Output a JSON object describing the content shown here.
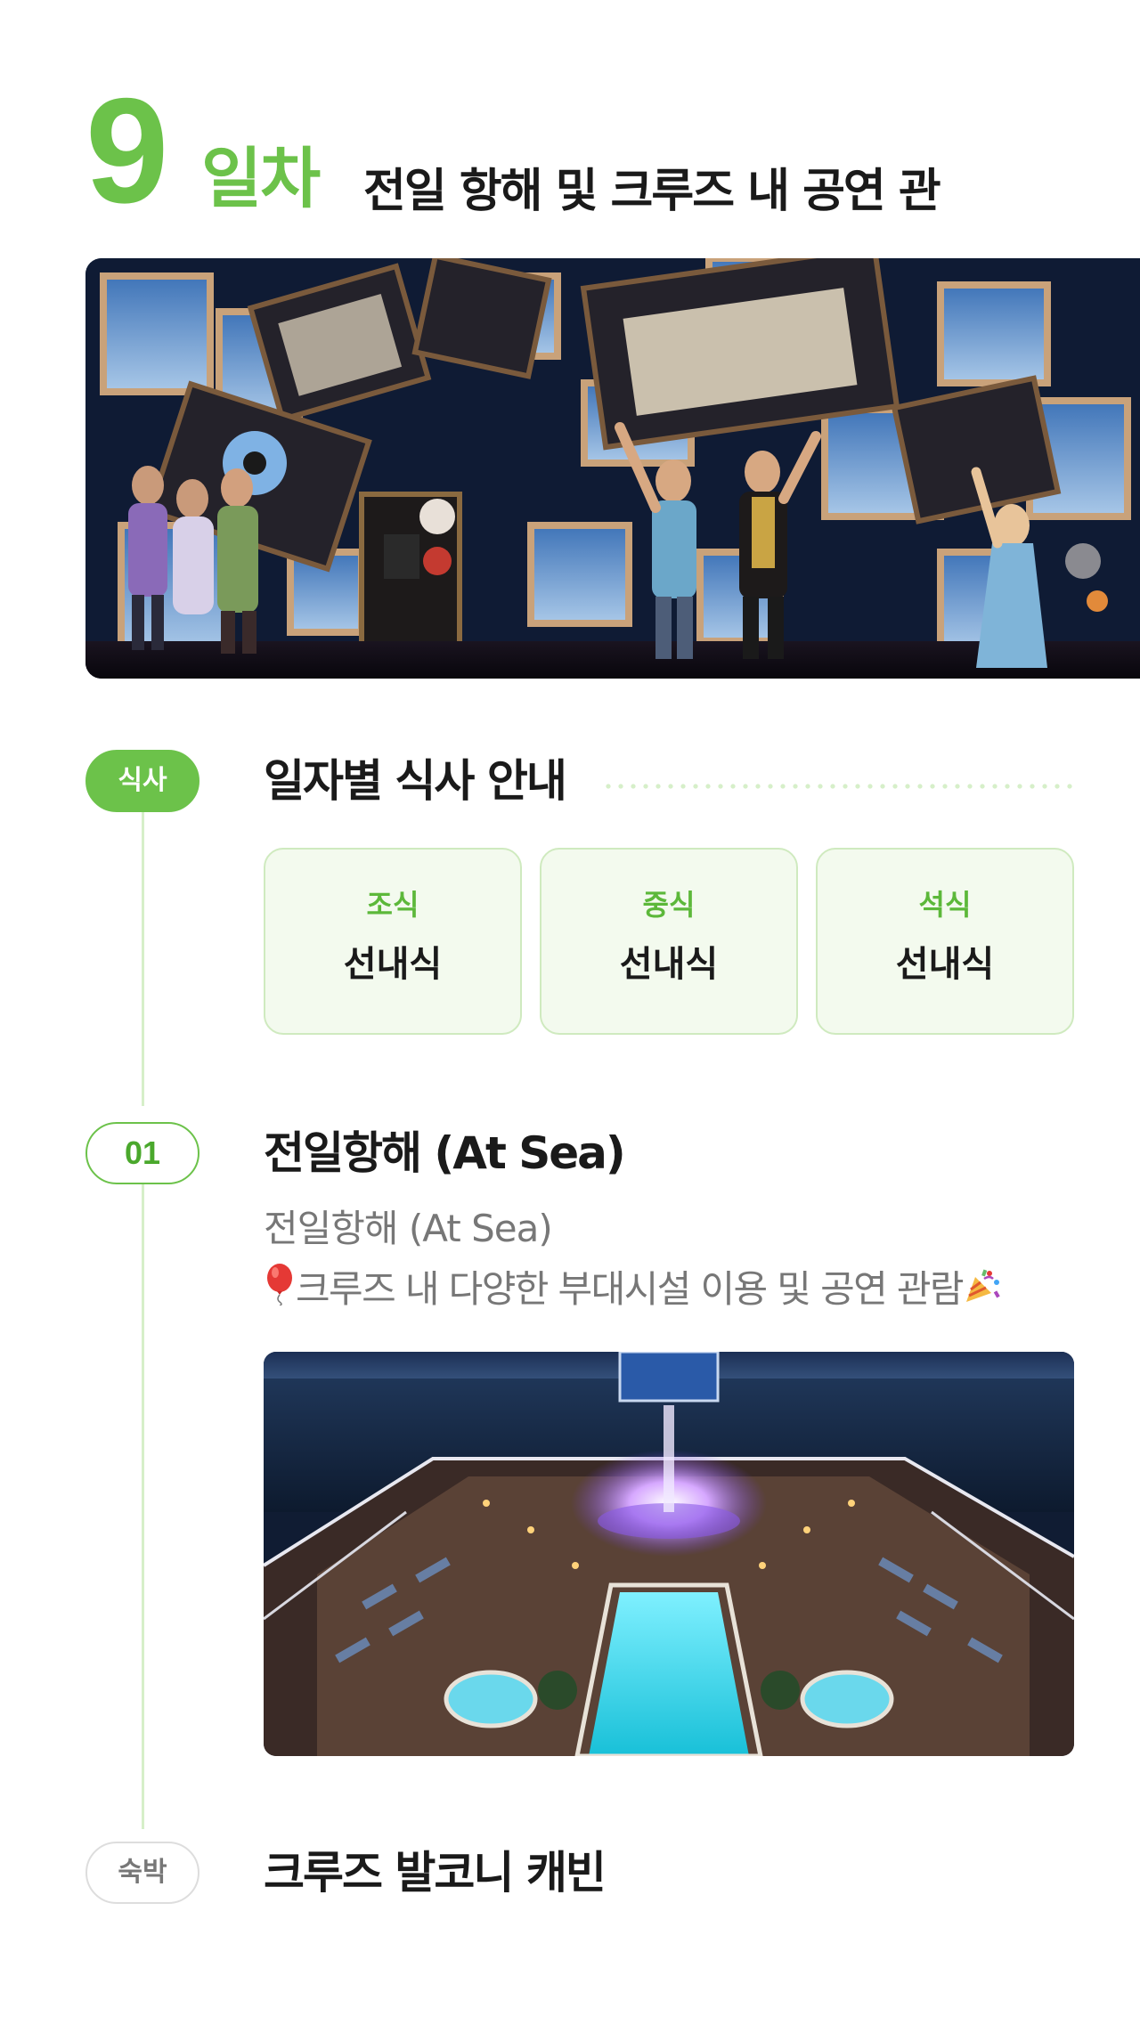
{
  "day": {
    "number": "9",
    "unit": "일차",
    "title": "전일 항해 및 크루즈 내 공연 관"
  },
  "hero_image": {
    "description_icon": "theatre-stage-photo"
  },
  "meals": {
    "badge": "식사",
    "title": "일자별 식사 안내",
    "items": [
      {
        "label": "조식",
        "value": "선내식"
      },
      {
        "label": "중식",
        "value": "선내식"
      },
      {
        "label": "석식",
        "value": "선내식"
      }
    ]
  },
  "step": {
    "badge": "01",
    "title": "전일항해 (At Sea)",
    "subtitle": "전일항해 (At Sea)",
    "description": "크루즈 내 다양한 부대시설 이용 및 공연 관람",
    "lead_icon": "balloon-icon",
    "trail_icon": "party-popper-icon"
  },
  "stay": {
    "badge": "숙박",
    "title": "크루즈 발코니 캐빈"
  },
  "colors": {
    "accent": "#6cc24a",
    "accent_light": "#f3faee",
    "accent_border": "#cfeabf",
    "timeline": "#d6efc9",
    "muted_text": "#777777"
  }
}
